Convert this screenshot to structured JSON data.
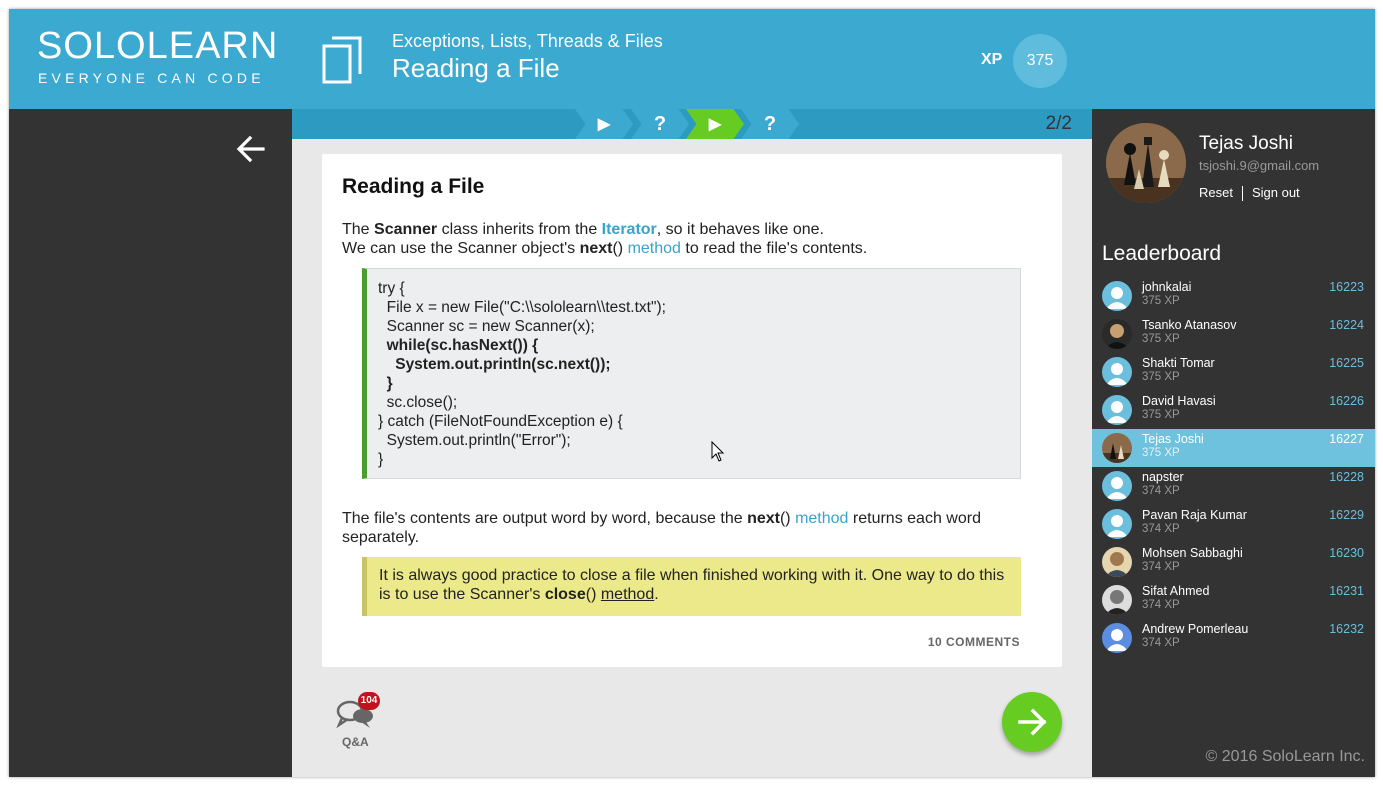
{
  "header": {
    "logo_main": "SOLOLEARN",
    "logo_sub": "EVERYONE CAN CODE",
    "course_title": "Exceptions, Lists, Threads & Files",
    "lesson_title": "Reading a File",
    "xp_label": "XP",
    "xp_value": "375",
    "course_icon": "copy-pages-icon"
  },
  "nav": {
    "back_icon": "arrow-left-icon",
    "steps": [
      {
        "glyph": "▶",
        "kind": "lesson",
        "active": false
      },
      {
        "glyph": "?",
        "kind": "quiz",
        "active": false
      },
      {
        "glyph": "▶",
        "kind": "lesson",
        "active": true
      },
      {
        "glyph": "?",
        "kind": "quiz",
        "active": false
      }
    ],
    "step_count": "2/2"
  },
  "lesson": {
    "heading": "Reading a File",
    "p1_a": "The ",
    "p1_scanner": "Scanner",
    "p1_b": " class inherits from the ",
    "p1_iterator": "Iterator",
    "p1_c": ", so it behaves like one.",
    "p2_a": "We can use the Scanner object's ",
    "p2_next": "next",
    "p2_parens": "()",
    "p2_method": "method",
    "p2_b": " to read the file's contents.",
    "code": {
      "l1": "try {",
      "l2": "  File x = new File(\"C:\\\\sololearn\\\\test.txt\");",
      "l3": "  Scanner sc = new Scanner(x);",
      "l4": "  while(sc.hasNext()) {",
      "l5": "    System.out.println(sc.next());",
      "l6": "  }",
      "l7": "  sc.close();",
      "l8": "} catch (FileNotFoundException e) {",
      "l9": "  System.out.println(\"Error\");",
      "l10": "}"
    },
    "p3_a": "The file's contents are output word by word, because the ",
    "p3_next": "next",
    "p3_parens": "()",
    "p3_method": "method",
    "p3_b": " returns each word separately.",
    "note_a": "It is always good practice to close a file when finished working with it. One way to do this is to use the Scanner's ",
    "note_close": "close",
    "note_parens": "()",
    "note_method": "method",
    "note_end": ".",
    "comments": "10 COMMENTS"
  },
  "qa": {
    "label": "Q&A",
    "badge": "104",
    "icon": "speech-bubbles-icon"
  },
  "next_icon": "arrow-right-icon",
  "profile": {
    "name": "Tejas Joshi",
    "email": "tsjoshi.9@gmail.com",
    "reset": "Reset",
    "sign_out": "Sign out",
    "avatar": "chess-pieces-avatar"
  },
  "leaderboard": {
    "title": "Leaderboard",
    "rows": [
      {
        "name": "johnkalai",
        "xp": "375 XP",
        "rank": "16223",
        "avatar": "default"
      },
      {
        "name": "Tsanko Atanasov",
        "xp": "375 XP",
        "rank": "16224",
        "avatar": "photo-dark"
      },
      {
        "name": "Shakti Tomar",
        "xp": "375 XP",
        "rank": "16225",
        "avatar": "default"
      },
      {
        "name": "David Havasi",
        "xp": "375 XP",
        "rank": "16226",
        "avatar": "default"
      },
      {
        "name": "Tejas Joshi",
        "xp": "375 XP",
        "rank": "16227",
        "avatar": "photo-chess",
        "me": true
      },
      {
        "name": "napster",
        "xp": "374 XP",
        "rank": "16228",
        "avatar": "default"
      },
      {
        "name": "Pavan Raja Kumar",
        "xp": "374 XP",
        "rank": "16229",
        "avatar": "default"
      },
      {
        "name": "Mohsen Sabbaghi",
        "xp": "374 XP",
        "rank": "16230",
        "avatar": "photo-person"
      },
      {
        "name": "Sifat Ahmed",
        "xp": "374 XP",
        "rank": "16231",
        "avatar": "photo-bw"
      },
      {
        "name": "Andrew Pomerleau",
        "xp": "374 XP",
        "rank": "16232",
        "avatar": "default-blue"
      }
    ]
  },
  "footer": {
    "copyright": "© 2016 SoloLearn Inc."
  },
  "colors": {
    "brand_blue": "#3ba9d0",
    "accent_green": "#66cc22",
    "panel_dark": "#333333",
    "note_yellow": "#ece98a",
    "badge_red": "#c1121e"
  }
}
